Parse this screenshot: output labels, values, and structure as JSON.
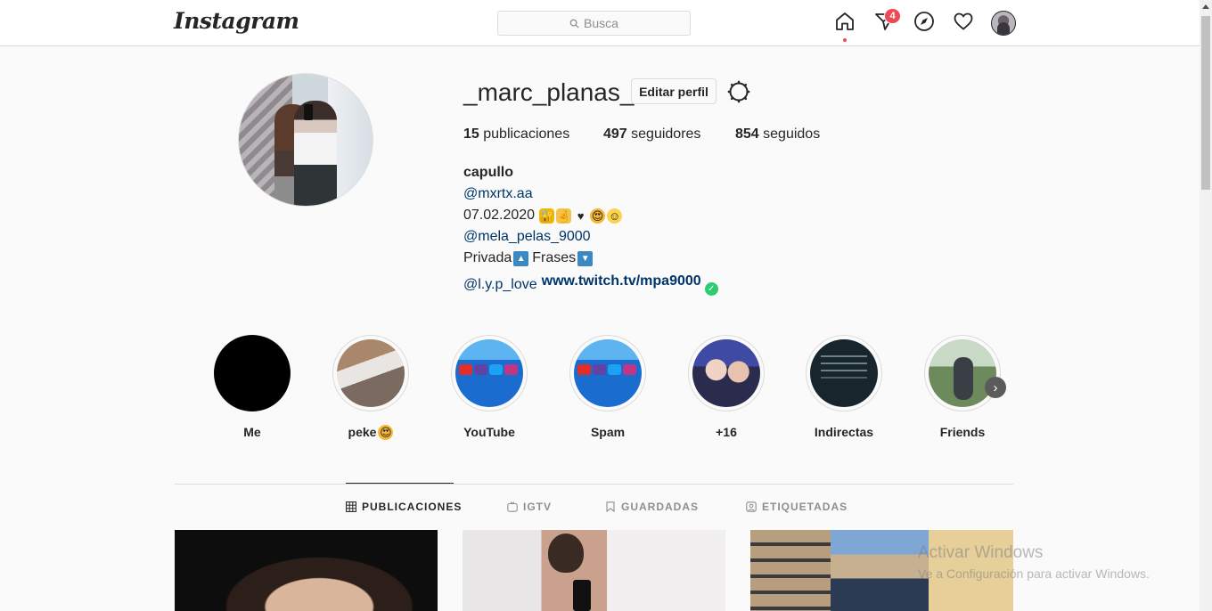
{
  "nav": {
    "logo": "Instagram",
    "search_placeholder": "Busca",
    "notification_count": "4"
  },
  "profile": {
    "username": "_marc_planas_",
    "edit_button": "Editar perfil",
    "stats": [
      {
        "count": "15",
        "label": "publicaciones"
      },
      {
        "count": "497",
        "label": "seguidores"
      },
      {
        "count": "854",
        "label": "seguidos"
      }
    ],
    "bio": {
      "name": "capullo",
      "mention1": "@mxrtx.aa",
      "date": "07.02.2020",
      "mention2": "@mela_pelas_9000",
      "privada": "Privada",
      "frases": "Frases",
      "mention3": "@l.y.p_love",
      "website": "www.twitch.tv/mpa9000"
    }
  },
  "highlights": [
    {
      "label": "Me"
    },
    {
      "label": "peke"
    },
    {
      "label": "YouTube"
    },
    {
      "label": "Spam"
    },
    {
      "label": "+16"
    },
    {
      "label": "Indirectas"
    },
    {
      "label": "Friends"
    }
  ],
  "tabs": [
    {
      "label": "PUBLICACIONES",
      "active": true
    },
    {
      "label": "IGTV",
      "active": false
    },
    {
      "label": "GUARDADAS",
      "active": false
    },
    {
      "label": "ETIQUETADAS",
      "active": false
    }
  ],
  "watermark": {
    "line1": "Activar Windows",
    "line2": "Ve a Configuración para activar Windows."
  },
  "colors": {
    "link": "#003569",
    "badge": "#ed4956",
    "border": "#dbdbdb",
    "text": "#262626"
  }
}
